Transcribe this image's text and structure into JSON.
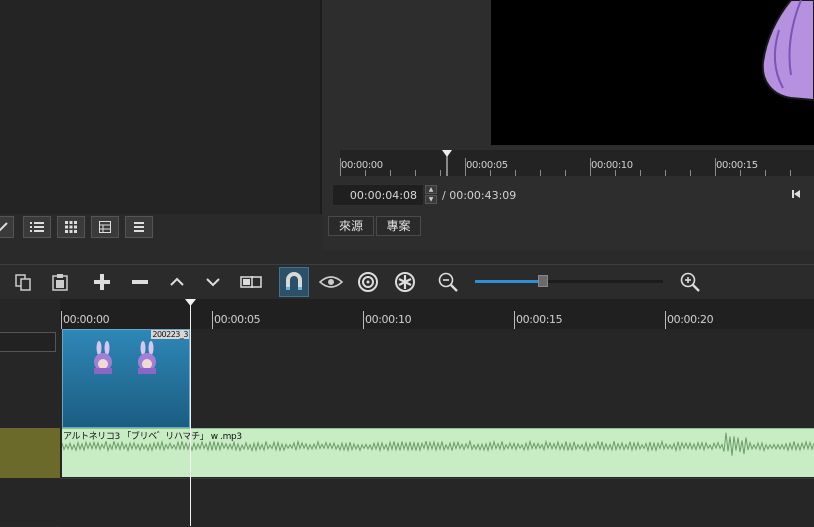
{
  "player": {
    "ruler_labels": [
      "00:00:00",
      "00:00:05",
      "00:00:10",
      "00:00:15"
    ],
    "current_time": "00:00:04:08",
    "duration": "/ 00:00:43:09"
  },
  "tabs": {
    "source": "來源",
    "project": "專案"
  },
  "timeline": {
    "ruler_labels": [
      "00:00:00",
      "00:00:05",
      "00:00:10",
      "00:00:15",
      "00:00:20"
    ],
    "video_clip_name": "200223_3",
    "audio_clip_name": "アルトネリコ3 「ブリベ゛リハマチ」 w .mp3",
    "zoom_level": 0.36
  },
  "icons": {
    "copy": "copy-icon",
    "paste": "paste-icon",
    "append": "plus-icon",
    "remove": "minus-icon",
    "lift": "chevron-up-icon",
    "overwrite": "chevron-down-icon",
    "split": "split-icon",
    "snap": "magnet-icon",
    "scrub": "eye-icon",
    "ripple": "target-icon",
    "ripple_all": "ripple-all-icon",
    "zoom_out": "zoom-out-icon",
    "zoom_in": "zoom-in-icon"
  },
  "colors": {
    "accent": "#2f8fd0",
    "video_clip": "#2e87b6",
    "audio_clip": "#c8ecc4",
    "audio_head": "#6b6a2a"
  }
}
